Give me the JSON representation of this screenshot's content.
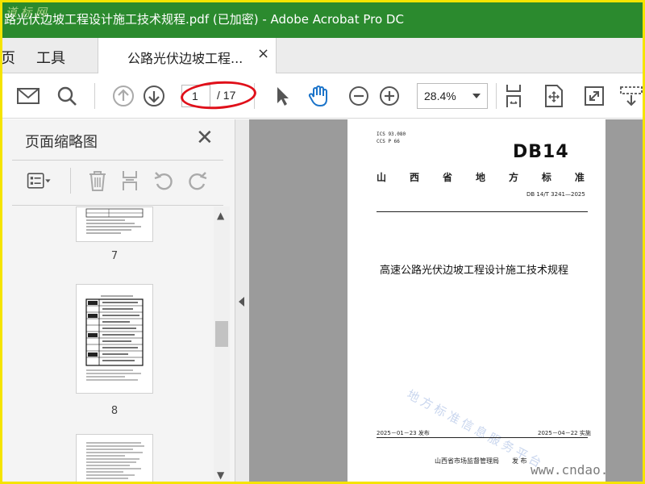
{
  "window": {
    "title": "路光伏边坡工程设计施工技术规程.pdf  (已加密)  - Adobe Acrobat Pro DC",
    "logo_text": "道 标 网"
  },
  "tabs": {
    "home_partial": "页",
    "tools": "工具",
    "document_tab": "公路光伏边坡工程...",
    "close_symbol": "×"
  },
  "toolbar": {
    "page_current": "1",
    "page_total": "/ 17",
    "zoom": "28.4%",
    "highlight_color": "#e0101a",
    "accent_color": "#2b8a2e"
  },
  "panel": {
    "title": "页面缩略图",
    "close_symbol": "✕",
    "thumbnails": [
      {
        "page_label": "7"
      },
      {
        "page_label": "8"
      },
      {
        "page_label": ""
      }
    ]
  },
  "document": {
    "ics": "ICS  93.080",
    "ccs": "CCS  P 66",
    "db_logo": "DB14",
    "province_chars": [
      "山",
      "西",
      "省",
      "地",
      "方",
      "标",
      "准"
    ],
    "standard_number": "DB 14/T  3241—2025",
    "title": "高速公路光伏边坡工程设计施工技术规程",
    "watermark": "地方标准信息服务平台",
    "publish_date": "2025－01－23 发布",
    "implement_date": "2025－04－22 实施",
    "issuer": "山西省市场监督管理局　　发 布"
  },
  "site_watermark": "www.cndao."
}
